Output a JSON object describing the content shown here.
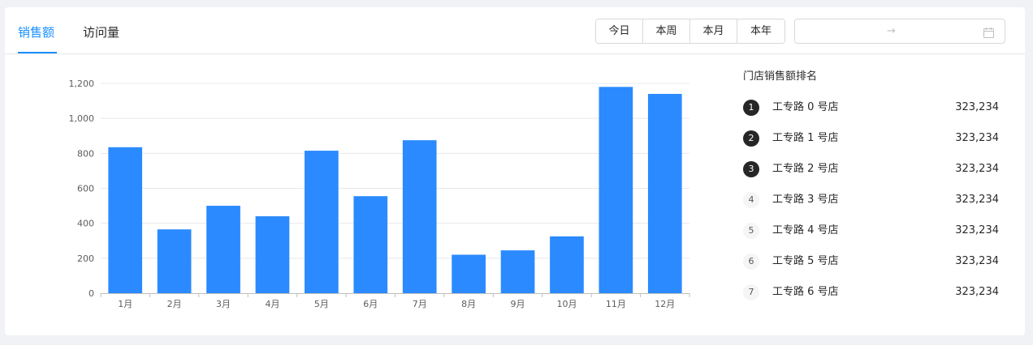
{
  "tabs": [
    {
      "label": "销售额",
      "active": true
    },
    {
      "label": "访问量",
      "active": false
    }
  ],
  "range_buttons": [
    "今日",
    "本周",
    "本月",
    "本年"
  ],
  "date_picker": {
    "start_placeholder": "",
    "separator": "→",
    "end_placeholder": "",
    "icon": "calendar-icon"
  },
  "colors": {
    "accent": "#1890ff",
    "bar": "#2b8aff",
    "top_badge": "#262626"
  },
  "chart_data": {
    "type": "bar",
    "categories": [
      "1月",
      "2月",
      "3月",
      "4月",
      "5月",
      "6月",
      "7月",
      "8月",
      "9月",
      "10月",
      "11月",
      "12月"
    ],
    "values": [
      835,
      365,
      500,
      440,
      815,
      555,
      875,
      220,
      245,
      325,
      1180,
      1140
    ],
    "title": "",
    "xlabel": "",
    "ylabel": "",
    "ylim": [
      0,
      1200
    ],
    "yticks": [
      0,
      200,
      400,
      600,
      800,
      1000,
      1200
    ],
    "ytick_labels": [
      "0",
      "200",
      "400",
      "600",
      "800",
      "1,000",
      "1,200"
    ],
    "grid": true,
    "legend": "none"
  },
  "ranking": {
    "title": "门店销售额排名",
    "items": [
      {
        "rank": "1",
        "name": "工专路 0 号店",
        "value": "323,234"
      },
      {
        "rank": "2",
        "name": "工专路 1 号店",
        "value": "323,234"
      },
      {
        "rank": "3",
        "name": "工专路 2 号店",
        "value": "323,234"
      },
      {
        "rank": "4",
        "name": "工专路 3 号店",
        "value": "323,234"
      },
      {
        "rank": "5",
        "name": "工专路 4 号店",
        "value": "323,234"
      },
      {
        "rank": "6",
        "name": "工专路 5 号店",
        "value": "323,234"
      },
      {
        "rank": "7",
        "name": "工专路 6 号店",
        "value": "323,234"
      }
    ]
  }
}
